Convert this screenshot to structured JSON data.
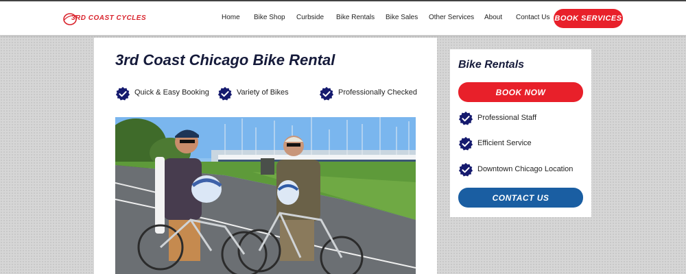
{
  "brand": {
    "logo_text": "3RD COAST CYCLES",
    "accent": "#e8202a",
    "navy": "#151a3a",
    "blue": "#1a5ea2"
  },
  "nav": {
    "items": [
      "Home",
      "Bike Shop",
      "Curbside",
      "Bike Rentals",
      "Bike Sales",
      "Other Services",
      "About",
      "Contact Us"
    ],
    "cta": "BOOK SERVICES"
  },
  "main": {
    "title": "3rd Coast Chicago Bike Rental",
    "features": [
      {
        "label": "Quick & Easy Booking",
        "icon": "verified-badge-icon"
      },
      {
        "label": "Variety of Bikes",
        "icon": "verified-badge-icon"
      },
      {
        "label": "Professionally Checked",
        "icon": "verified-badge-icon"
      }
    ]
  },
  "sidebar": {
    "title": "Bike Rentals",
    "book_now": "BOOK NOW",
    "features": [
      {
        "label": "Professional Staff",
        "icon": "verified-badge-icon"
      },
      {
        "label": "Efficient Service",
        "icon": "verified-badge-icon"
      },
      {
        "label": "Downtown Chicago Location",
        "icon": "verified-badge-icon"
      }
    ],
    "contact": "CONTACT US"
  }
}
